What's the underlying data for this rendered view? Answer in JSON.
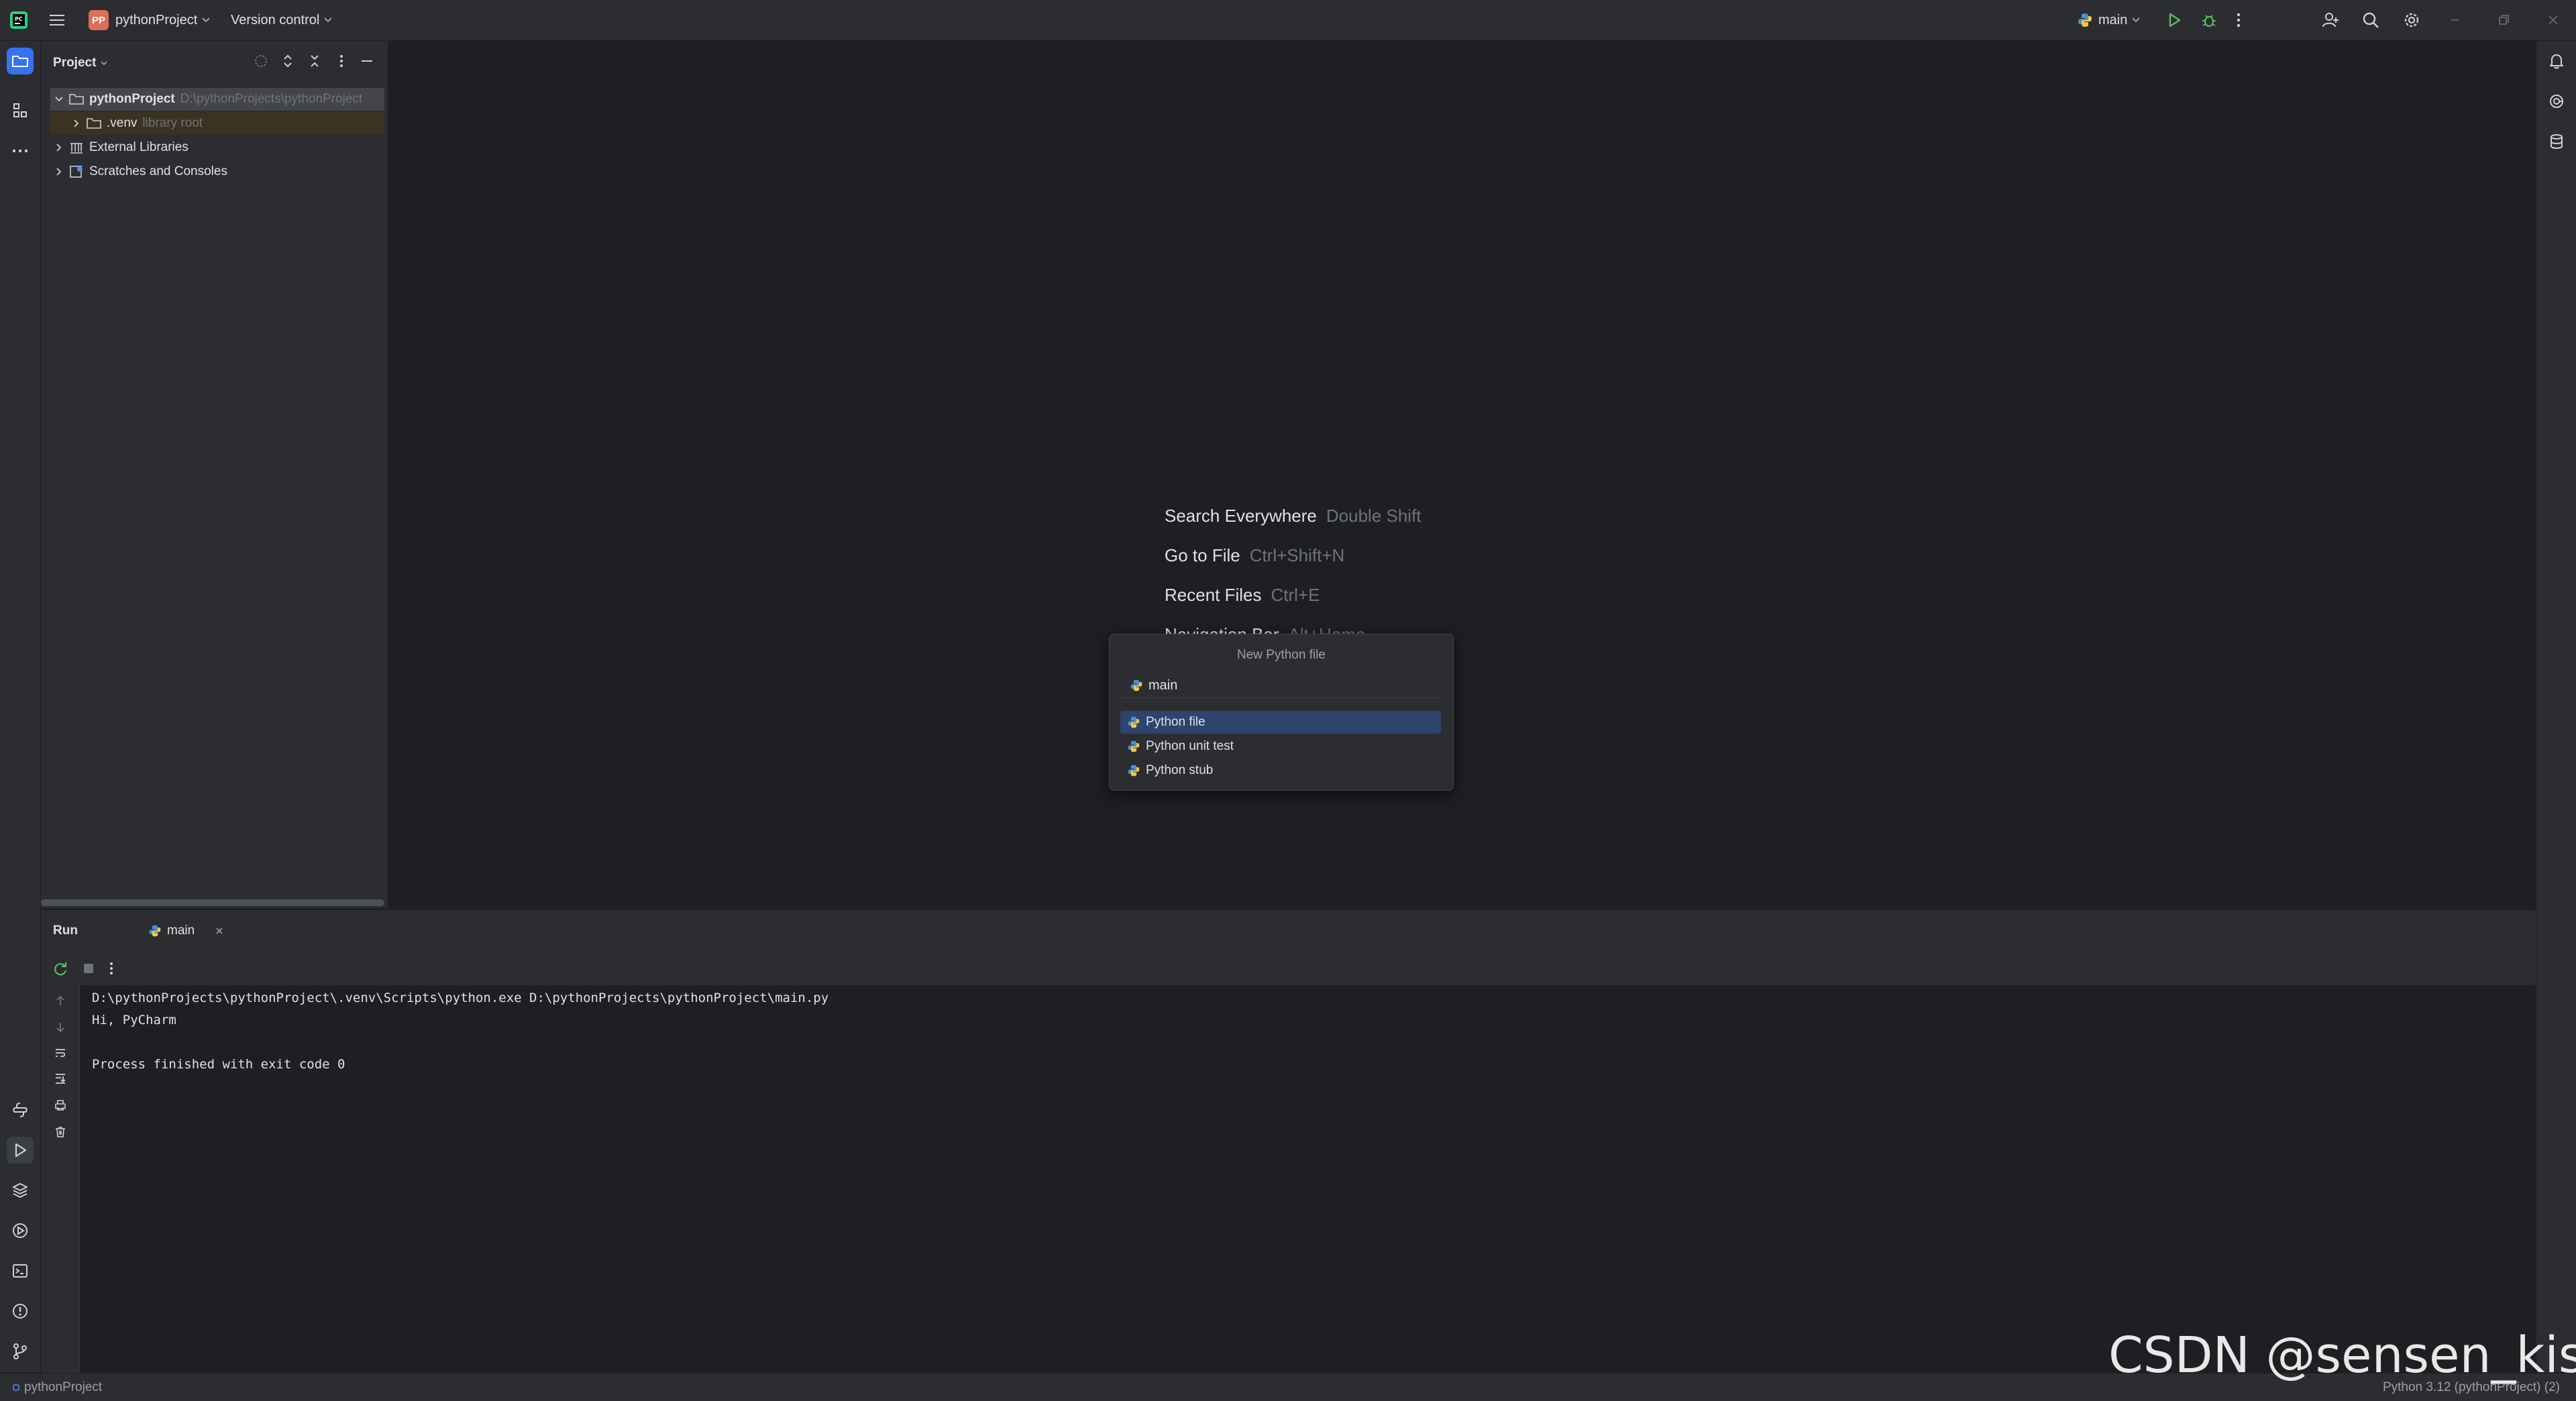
{
  "titlebar": {
    "project_badge": "PP",
    "project_name": "pythonProject",
    "vcs_label": "Version control",
    "run_config": "main"
  },
  "project_panel": {
    "title": "Project",
    "tree": [
      {
        "label": "pythonProject",
        "hint": "D:\\pythonProjects\\pythonProject"
      },
      {
        "label": ".venv",
        "hint": "library root"
      },
      {
        "label": "External Libraries",
        "hint": ""
      },
      {
        "label": "Scratches and Consoles",
        "hint": ""
      }
    ]
  },
  "editor": {
    "hints": [
      {
        "action": "Search Everywhere",
        "shortcut": "Double Shift"
      },
      {
        "action": "Go to File",
        "shortcut": "Ctrl+Shift+N"
      },
      {
        "action": "Recent Files",
        "shortcut": "Ctrl+E"
      },
      {
        "action": "Navigation Bar",
        "shortcut": "Alt+Home"
      }
    ]
  },
  "popup": {
    "title": "New Python file",
    "input_value": "main",
    "items": [
      "Python file",
      "Python unit test",
      "Python stub"
    ],
    "selected_index": 0
  },
  "run_panel": {
    "title": "Run",
    "tab_label": "main",
    "console_lines": [
      "D:\\pythonProjects\\pythonProject\\.venv\\Scripts\\python.exe D:\\pythonProjects\\pythonProject\\main.py",
      "Hi, PyCharm",
      "",
      "Process finished with exit code 0"
    ]
  },
  "statusbar": {
    "project": "pythonProject",
    "interpreter": "Python 3.12 (pythonProject) (2)"
  },
  "watermark": "CSDN @sensen_kiss",
  "colors": {
    "accent": "#3574f0",
    "panel_bg": "#2b2d30",
    "editor_bg": "#1e1f22",
    "selection": "#2e436e",
    "run_green": "#5fb865"
  },
  "icons": [
    "app-logo-icon",
    "hamburger-menu-icon",
    "python-icon",
    "run-icon",
    "debug-icon",
    "more-icon",
    "add-user-icon",
    "search-icon",
    "settings-icon",
    "minimize-icon",
    "restore-icon",
    "close-icon",
    "folder-icon",
    "structure-icon",
    "bell-icon",
    "ai-assistant-icon",
    "database-icon",
    "python-console-icon",
    "run-tool-icon",
    "layers-icon",
    "services-icon",
    "terminal-icon",
    "problems-icon",
    "git-icon"
  ]
}
